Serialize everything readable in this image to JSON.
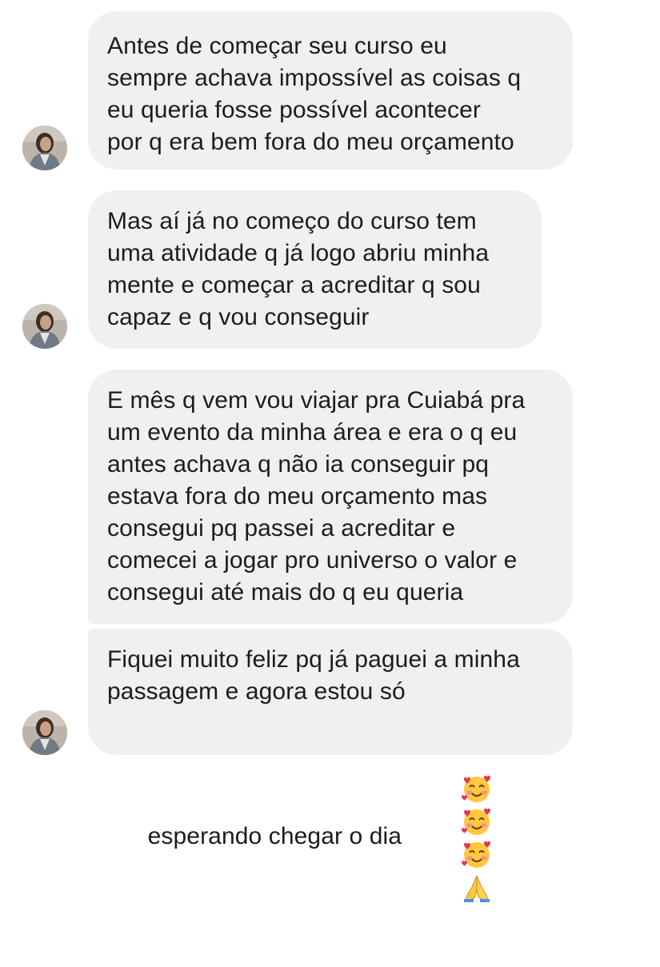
{
  "chat": {
    "messages": [
      {
        "lines": [
          "Antes de começar seu curso eu",
          "sempre achava impossível as coisas q",
          "eu queria fosse possível acontecer",
          "por q era bem fora do meu orçamento"
        ]
      },
      {
        "lines": [
          "Mas aí já no começo do curso tem",
          "uma atividade q já logo abriu minha",
          "mente e começar a acreditar q sou",
          "capaz e q vou conseguir"
        ]
      },
      {
        "lines": [
          "E mês q vem vou viajar pra Cuiabá pra",
          "um evento da minha área e era o q eu",
          "antes achava q não ia conseguir pq",
          "estava fora do meu orçamento mas",
          "consegui pq passei a acreditar e",
          "comecei a jogar pro universo o valor e",
          "consegui até mais do q eu queria"
        ]
      },
      {
        "lines": [
          "Fiquei muito feliz pq já paguei a minha",
          "passagem e agora estou só",
          "esperando chegar o dia"
        ],
        "emojis": [
          "smiling-face-with-hearts",
          "smiling-face-with-hearts",
          "smiling-face-with-hearts",
          "folded-hands"
        ]
      }
    ],
    "colors": {
      "bubble": "#f0f0f2",
      "text": "#1c1c1e"
    }
  }
}
